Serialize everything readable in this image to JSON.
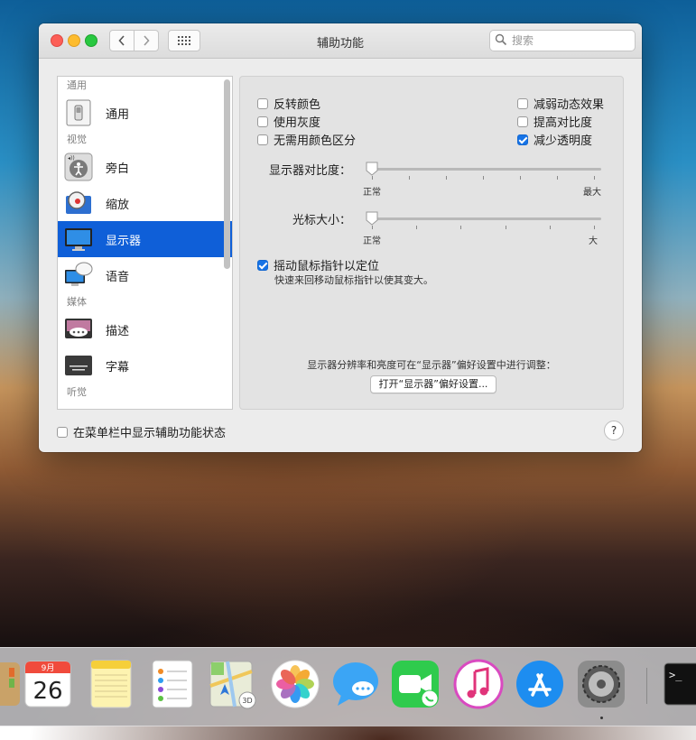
{
  "window": {
    "title": "辅助功能",
    "search_placeholder": "搜索"
  },
  "sidebar": {
    "sections": [
      {
        "header": "通用",
        "items": [
          {
            "label": "通用",
            "icon": "general-switch-icon"
          }
        ]
      },
      {
        "header": "视觉",
        "items": [
          {
            "label": "旁白",
            "icon": "voiceover-icon"
          },
          {
            "label": "缩放",
            "icon": "zoom-icon"
          },
          {
            "label": "显示器",
            "icon": "display-icon",
            "selected": true
          },
          {
            "label": "语音",
            "icon": "speech-icon"
          }
        ]
      },
      {
        "header": "媒体",
        "items": [
          {
            "label": "描述",
            "icon": "descriptions-icon"
          },
          {
            "label": "字幕",
            "icon": "captions-icon"
          }
        ]
      },
      {
        "header": "听觉",
        "items": []
      }
    ]
  },
  "display": {
    "checkboxes_left": [
      {
        "label": "反转颜色",
        "checked": false
      },
      {
        "label": "使用灰度",
        "checked": false
      },
      {
        "label": "无需用颜色区分",
        "checked": false
      }
    ],
    "checkboxes_right": [
      {
        "label": "减弱动态效果",
        "checked": false
      },
      {
        "label": "提高对比度",
        "checked": false
      },
      {
        "label": "减少透明度",
        "checked": true
      }
    ],
    "contrast_slider": {
      "label": "显示器对比度：",
      "min_label": "正常",
      "max_label": "最大",
      "value": 0
    },
    "cursor_slider": {
      "label": "光标大小：",
      "min_label": "正常",
      "max_label": "大",
      "value": 0
    },
    "shake_option": {
      "label": "摇动鼠标指针以定位",
      "checked": true,
      "description": "快速来回移动鼠标指针以使其变大。"
    },
    "note": "显示器分辨率和亮度可在“显示器”偏好设置中进行调整：",
    "open_button": "打开“显示器”偏好设置..."
  },
  "footer": {
    "menu_status_label": "在菜单栏中显示辅助功能状态",
    "menu_status_checked": false,
    "help_label": "?"
  },
  "dock": {
    "items": [
      "contacts-icon",
      "calendar-icon",
      "notes-icon",
      "reminders-icon",
      "maps-icon",
      "photos-icon",
      "messages-icon",
      "facetime-icon",
      "itunes-icon",
      "app-store-icon",
      "system-preferences-icon",
      "terminal-icon"
    ],
    "calendar_month": "9月",
    "calendar_day": "26",
    "terminal_prompt": ">_"
  }
}
